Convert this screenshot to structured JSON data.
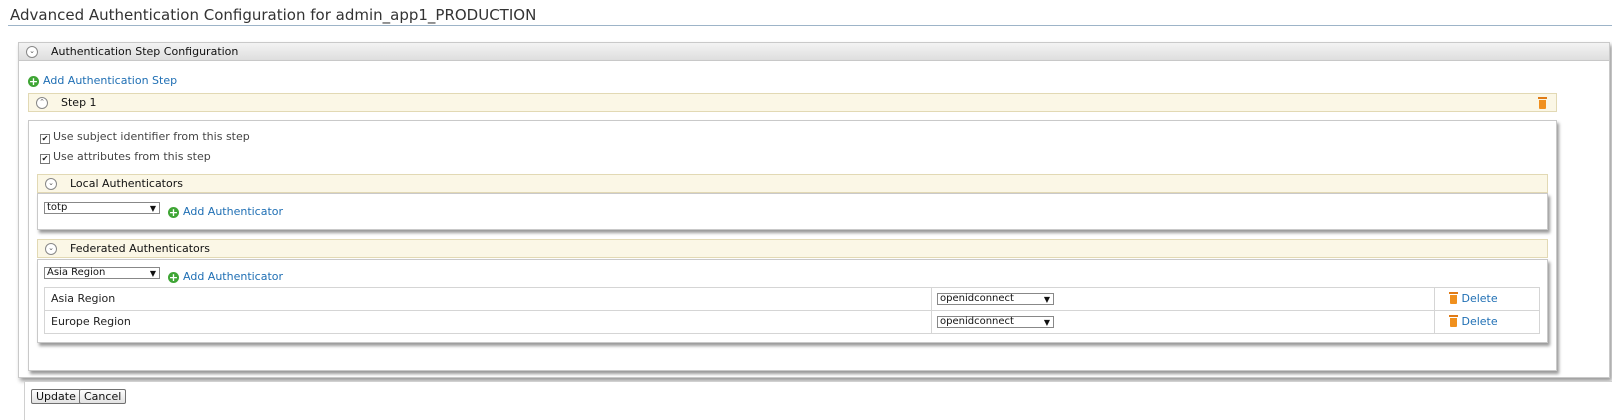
{
  "page": {
    "title": "Advanced Authentication Configuration for admin_app1_PRODUCTION"
  },
  "auth_step_config": {
    "header": "Authentication Step Configuration",
    "add_step_label": "Add Authentication Step"
  },
  "step": {
    "header": "Step 1",
    "use_subject_label": "Use subject identifier from this step",
    "use_subject_checked": true,
    "use_attributes_label": "Use attributes from this step",
    "use_attributes_checked": true
  },
  "local": {
    "header": "Local Authenticators",
    "selected": "totp",
    "add_label": "Add Authenticator"
  },
  "federated": {
    "header": "Federated Authenticators",
    "selected": "Asia Region",
    "add_label": "Add Authenticator",
    "rows": [
      {
        "name": "Asia Region",
        "authenticator": "openidconnect",
        "delete_label": "Delete"
      },
      {
        "name": "Europe Region",
        "authenticator": "openidconnect",
        "delete_label": "Delete"
      }
    ]
  },
  "footer": {
    "update_label": "Update",
    "cancel_label": "Cancel"
  },
  "icons": {
    "add": "add-circle-icon",
    "delete": "trash-icon",
    "collapse": "chevron-toggle-icon",
    "dropdown": "dropdown-arrow-icon"
  },
  "colors": {
    "link": "#1f6fb4",
    "add_icon": "#3fa535",
    "trash_icon": "#f0901e",
    "step_bar": "#fbf7e6"
  }
}
